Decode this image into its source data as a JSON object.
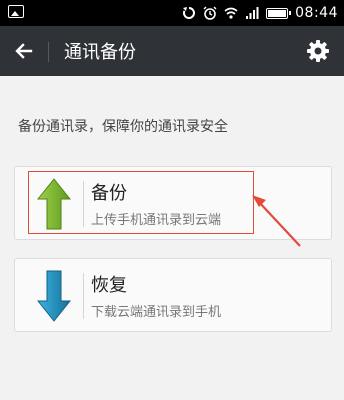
{
  "status_bar": {
    "time": "08:44",
    "icons": [
      "image-icon",
      "sync-icon",
      "alarm-icon",
      "wifi-icon",
      "signal-icon",
      "battery-icon"
    ]
  },
  "app_bar": {
    "title": "通讯备份",
    "back_icon": "back-arrow-icon",
    "settings_icon": "gear-icon"
  },
  "description": "备份通讯录，保障你的通讯录安全",
  "backup": {
    "label": "备份",
    "sublabel": "上传手机通讯录到云端",
    "icon": "upload-arrow-icon",
    "icon_color": "#7cb82f"
  },
  "restore": {
    "label": "恢复",
    "sublabel": "下载云端通讯录到手机",
    "icon": "download-arrow-icon",
    "icon_color": "#1f8bb8"
  },
  "colors": {
    "app_bar": "#2f3236",
    "background": "#f2f2f2",
    "annotation": "#e24a3a"
  }
}
